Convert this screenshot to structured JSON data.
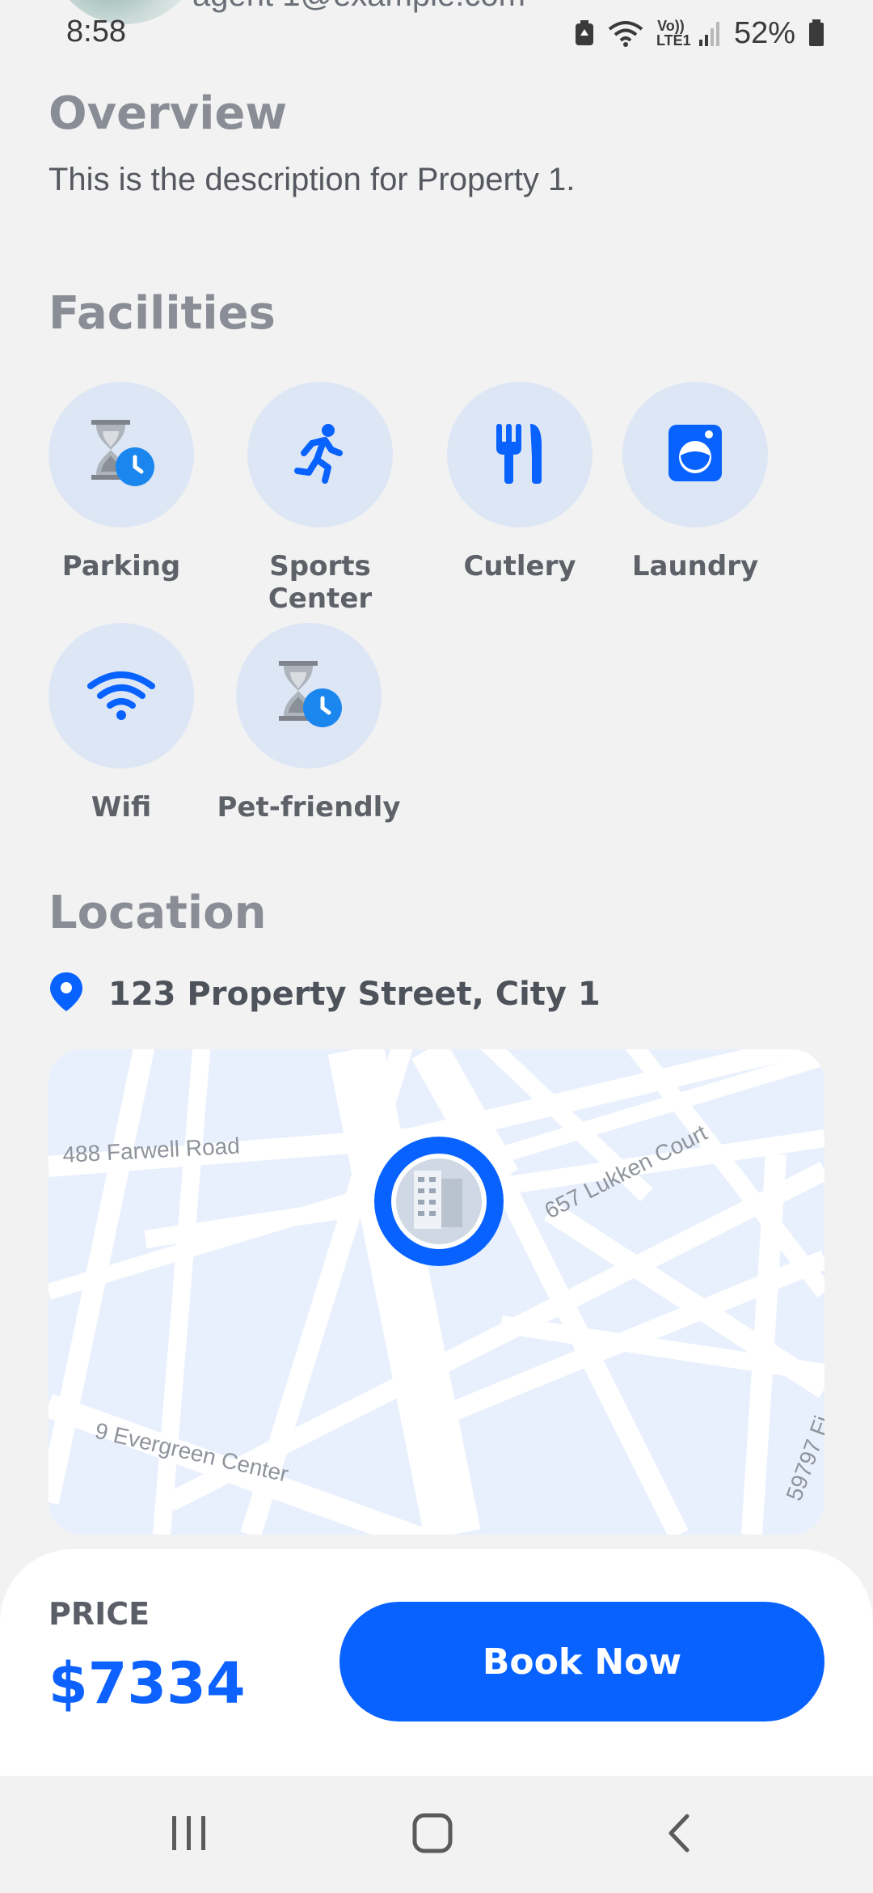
{
  "status_bar": {
    "time": "8:58",
    "battery": "52%",
    "volte": "Vo)) LTE1"
  },
  "agent": {
    "email": "agent 1@example.com"
  },
  "overview": {
    "title": "Overview",
    "description": "This is the description for Property 1."
  },
  "facilities": {
    "title": "Facilities",
    "items": [
      {
        "label": "Parking",
        "icon": "hourglass-clock-icon"
      },
      {
        "label": "Sports Center",
        "icon": "running-person-icon"
      },
      {
        "label": "Cutlery",
        "icon": "cutlery-icon"
      },
      {
        "label": "Laundry",
        "icon": "washing-machine-icon"
      },
      {
        "label": "Wifi",
        "icon": "wifi-icon"
      },
      {
        "label": "Pet-friendly",
        "icon": "hourglass-clock-icon"
      }
    ]
  },
  "location": {
    "title": "Location",
    "address": "123 Property Street, City 1",
    "map_labels": [
      "488 Farwell Road",
      "657 Lukken Court",
      "9 Evergreen Center",
      "59797 Fi"
    ]
  },
  "booking": {
    "price_label": "PRICE",
    "price": "$7334",
    "button_label": "Book Now"
  },
  "colors": {
    "accent": "#0762ff",
    "icon_bg": "#dde6f5",
    "map_bg": "#e9f0fd"
  }
}
